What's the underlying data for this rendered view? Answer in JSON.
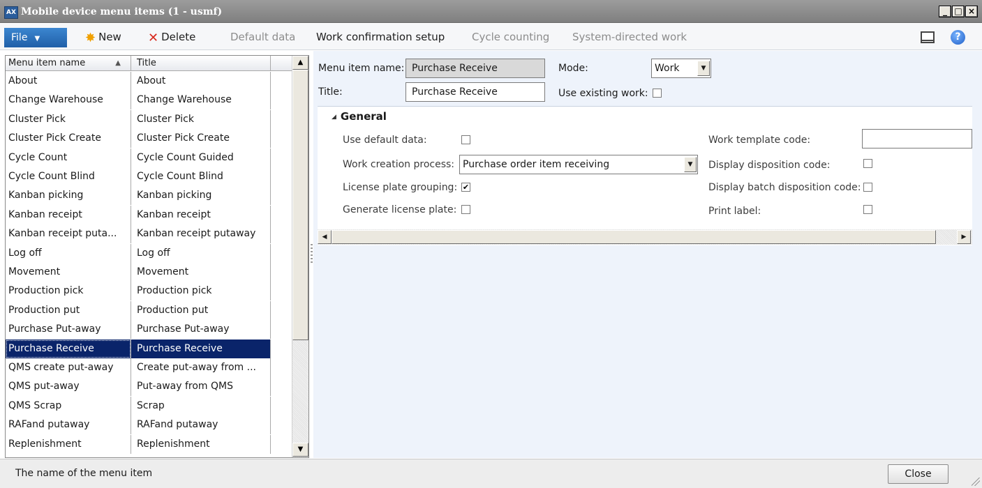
{
  "window": {
    "title": "Mobile device menu items (1 - usmf)",
    "controls": [
      "_",
      "□",
      "×"
    ]
  },
  "toolbar": {
    "file_label": "File",
    "new_label": "New",
    "delete_label": "Delete",
    "default_data_label": "Default data",
    "work_confirmation_label": "Work confirmation setup",
    "cycle_counting_label": "Cycle counting",
    "system_directed_label": "System-directed work",
    "help_glyph": "?"
  },
  "grid": {
    "columns": [
      "Menu item name",
      "Title"
    ],
    "sort_indicator": "▲",
    "selected_index": 15,
    "rows": [
      {
        "name": "About",
        "title": "About"
      },
      {
        "name": "Change Warehouse",
        "title": "Change Warehouse"
      },
      {
        "name": "Cluster Pick",
        "title": "Cluster Pick"
      },
      {
        "name": "Cluster Pick Create",
        "title": "Cluster Pick Create"
      },
      {
        "name": "Cycle Count",
        "title": "Cycle Count Guided"
      },
      {
        "name": "Cycle Count Blind",
        "title": "Cycle Count Blind"
      },
      {
        "name": "Kanban picking",
        "title": "Kanban picking"
      },
      {
        "name": "Kanban receipt",
        "title": "Kanban receipt"
      },
      {
        "name": "Kanban receipt puta...",
        "title": "Kanban receipt putaway"
      },
      {
        "name": "Log off",
        "title": "Log off"
      },
      {
        "name": "Movement",
        "title": "Movement"
      },
      {
        "name": "Production pick",
        "title": "Production pick"
      },
      {
        "name": "Production put",
        "title": "Production put"
      },
      {
        "name": "Purchase Put-away",
        "title": "Purchase Put-away"
      },
      {
        "name": "Purchase Receive",
        "title": "Purchase Receive"
      },
      {
        "name": "QMS create put-away",
        "title": "Create put-away from ..."
      },
      {
        "name": "QMS put-away",
        "title": "Put-away from QMS"
      },
      {
        "name": "QMS Scrap",
        "title": "Scrap"
      },
      {
        "name": "RAFand putaway",
        "title": "RAFand putaway"
      },
      {
        "name": "Replenishment",
        "title": "Replenishment"
      }
    ]
  },
  "header": {
    "menu_item_name_label": "Menu item name:",
    "menu_item_name_value": "Purchase Receive",
    "title_label": "Title:",
    "title_value": "Purchase Receive",
    "mode_label": "Mode:",
    "mode_value": "Work",
    "use_existing_work_label": "Use existing work:",
    "use_existing_work_checked": false
  },
  "general": {
    "heading": "General",
    "use_default_data_label": "Use default data:",
    "use_default_data_checked": false,
    "work_creation_process_label": "Work creation process:",
    "work_creation_process_value": "Purchase order item receiving",
    "license_plate_grouping_label": "License plate grouping:",
    "license_plate_grouping_checked": true,
    "generate_license_plate_label": "Generate license plate:",
    "generate_license_plate_checked": false,
    "work_template_code_label": "Work template code:",
    "work_template_code_value": "",
    "display_disposition_code_label": "Display disposition code:",
    "display_disposition_code_checked": false,
    "display_batch_disposition_code_label": "Display batch disposition code:",
    "display_batch_disposition_code_checked": false,
    "print_label_label": "Print label:",
    "print_label_checked": false
  },
  "status": {
    "text": "The name of the menu item",
    "close_label": "Close"
  },
  "icons": {
    "check_glyph": "✔"
  }
}
